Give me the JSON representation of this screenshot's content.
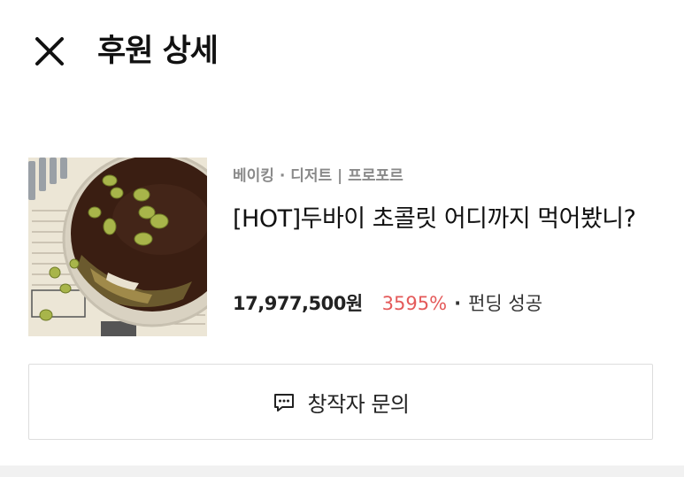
{
  "header": {
    "close_icon": "close-icon",
    "title": "후원 상세"
  },
  "project": {
    "category": "베이킹 · 디저트 | 프로포르",
    "title": "[HOT]두바이 초콜릿 어디까지 먹어봤니?",
    "amount": "17,977,500원",
    "percent": "3595%",
    "separator": "·",
    "status": "펀딩 성공",
    "colors": {
      "percent": "#e45a5a",
      "category": "#8a8a8a"
    }
  },
  "inquiry": {
    "icon": "chat-bubble-icon",
    "label": "창작자 문의"
  }
}
